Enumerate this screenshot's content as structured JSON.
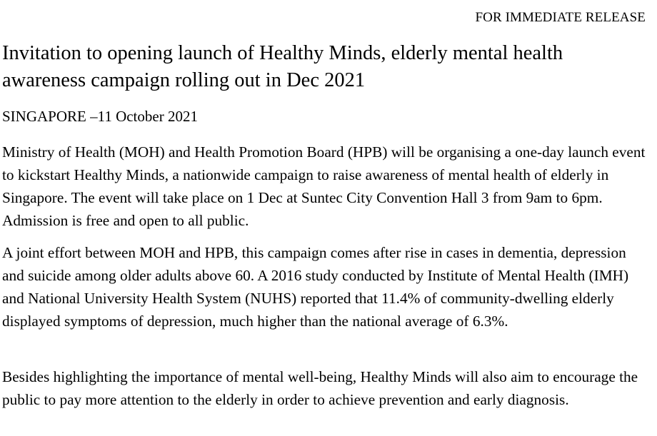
{
  "document": {
    "release_label": "FOR IMMEDIATE RELEASE",
    "title": "Invitation to opening launch of Healthy Minds, elderly mental health awareness campaign rolling out in Dec 2021",
    "dateline": "SINGAPORE –11 October 2021",
    "paragraphs": [
      "Ministry of Health (MOH) and Health Promotion Board (HPB) will be organising a one-day launch event to kickstart Healthy Minds, a nationwide campaign to raise awareness of mental health of elderly in Singapore. The event will take place on 1 Dec at Suntec City Convention Hall 3 from 9am to 6pm. Admission is free and open to all public.",
      "A joint effort between MOH and HPB, this campaign comes after rise in cases in dementia, depression and suicide among older adults above 60. A 2016 study conducted by Institute of Mental Health (IMH) and National University Health System (NUHS) reported that 11.4% of community-dwelling elderly displayed symptoms of depression, much higher than the national average of 6.3%.",
      "Besides highlighting the importance of mental well-being, Healthy Minds will also aim to encourage the public to pay more attention to the elderly in order to achieve prevention and early diagnosis."
    ]
  }
}
